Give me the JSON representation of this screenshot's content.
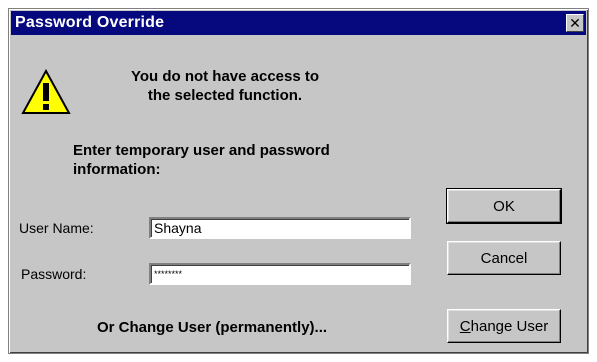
{
  "dialog": {
    "title": "Password Override",
    "close_glyph": "✕"
  },
  "warning": {
    "icon": "warning-icon",
    "line1": "You do not have access to",
    "line2": "the selected function."
  },
  "instructions": {
    "line1": "Enter temporary user and password",
    "line2": "information:"
  },
  "form": {
    "username_label": "User Name:",
    "username_value": "Shayna",
    "password_label": "Password:",
    "password_value": "********"
  },
  "buttons": {
    "ok": "OK",
    "cancel": "Cancel",
    "change_user_prefix": "C",
    "change_user_rest": "hange User"
  },
  "footer": {
    "change_text": "Or Change User (permanently)..."
  },
  "colors": {
    "titlebar": "#06087e",
    "face": "#c6c6c6",
    "warning_fill": "#ffff00"
  }
}
